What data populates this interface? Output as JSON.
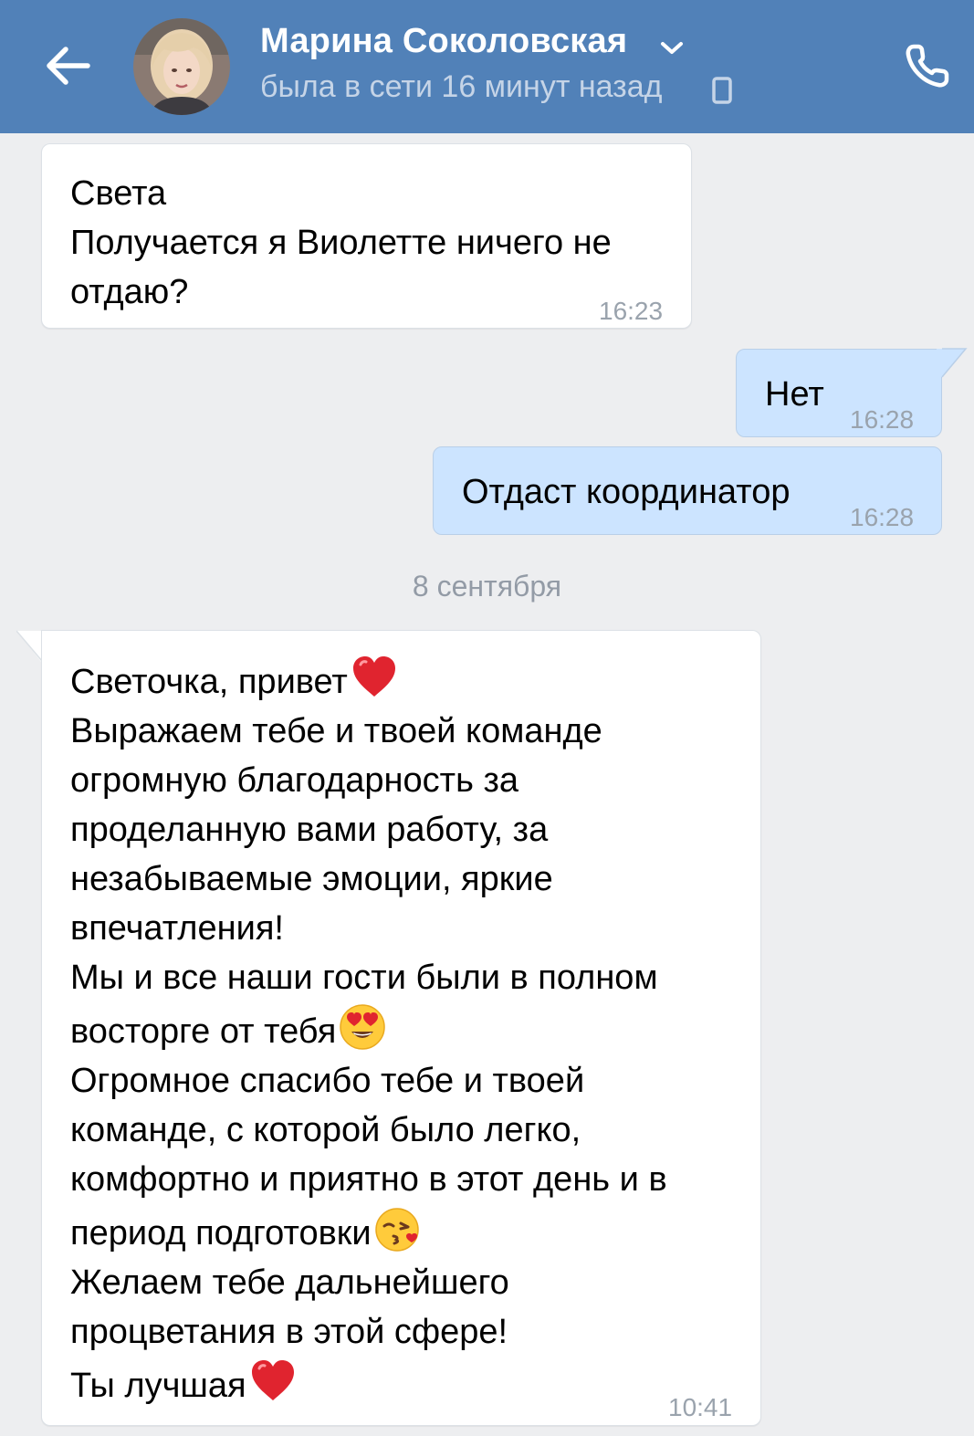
{
  "header": {
    "contact_name": "Марина Соколовская",
    "status": "была в сети 16 минут назад"
  },
  "messages": [
    {
      "direction": "incoming",
      "lines": [
        "Света",
        "Получается я Виолетте ничего не",
        "отдаю?"
      ],
      "time": "16:23"
    },
    {
      "direction": "outgoing",
      "lines": [
        "Нет"
      ],
      "time": "16:28"
    },
    {
      "direction": "outgoing",
      "lines": [
        "Отдаст координатор"
      ],
      "time": "16:28"
    },
    {
      "date_separator": "8 сентября"
    },
    {
      "direction": "incoming",
      "lines": [
        "Светочка, привет",
        "Выражаем тебе и твоей команде",
        "огромную благодарность за",
        "проделанную вами работу, за",
        "незабываемые эмоции, яркие",
        "впечатления!",
        "Мы и все наши гости были в полном",
        "восторге от тебя",
        "Огромное спасибо тебе и твоей",
        "команде, с которой было легко,",
        "комфортно и приятно в этот день и в",
        "период подготовки",
        "Желаем тебе дальнейшего",
        "процветания в этой сфере!",
        "Ты лучшая"
      ],
      "emojis": [
        "red-heart",
        "heart-eyes",
        "kissing-face",
        "red-heart"
      ],
      "time": "10:41"
    }
  ],
  "colors": {
    "header_bg": "#5181b8",
    "chat_bg": "#edeef0",
    "incoming_bubble": "#ffffff",
    "outgoing_bubble": "#cce4ff",
    "time_text": "#9aa3ad"
  }
}
